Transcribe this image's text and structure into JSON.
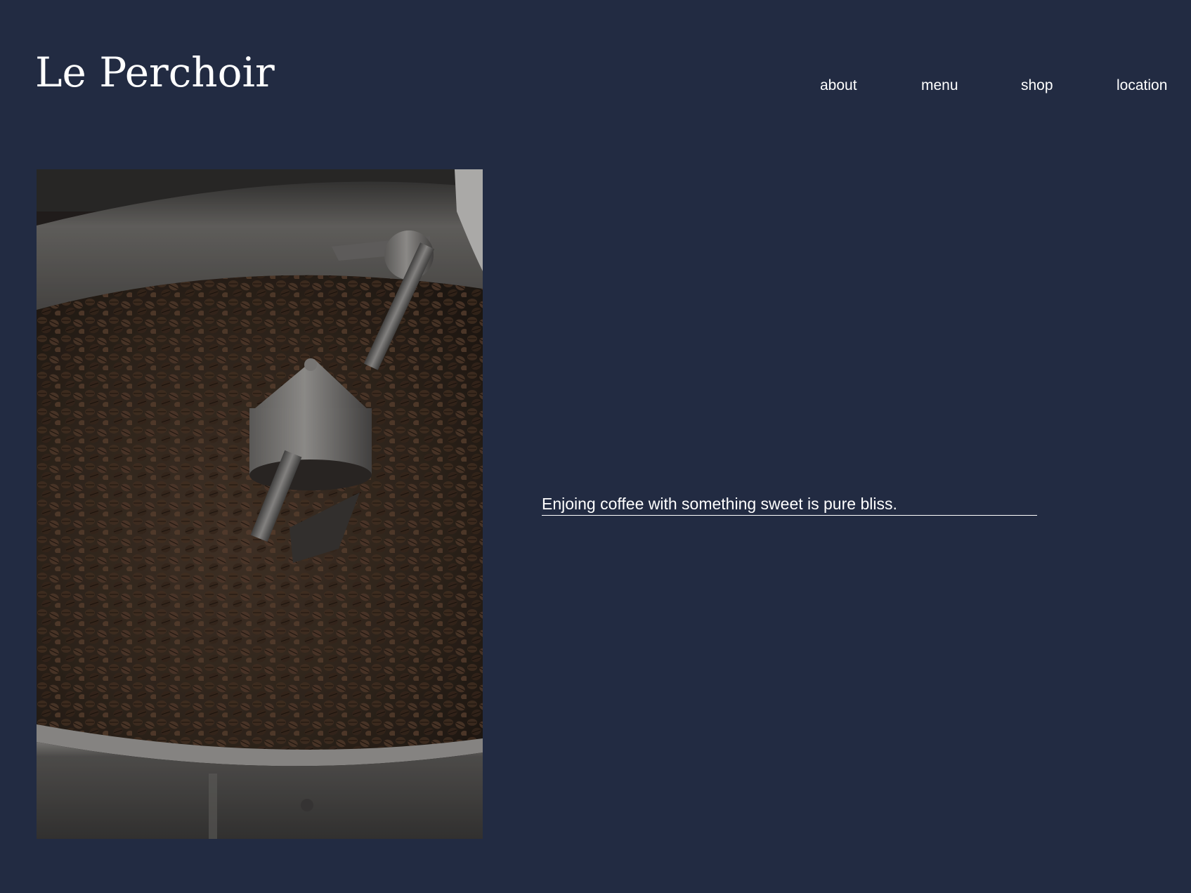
{
  "site": {
    "brand": "Le Perchoir"
  },
  "nav": {
    "items": [
      {
        "label": "about"
      },
      {
        "label": "menu"
      },
      {
        "label": "shop"
      },
      {
        "label": "location"
      }
    ]
  },
  "hero": {
    "image_subject": "coffee-roaster-image",
    "tagline": "Enjoing coffee with something sweet is pure bliss."
  },
  "colors": {
    "background": "#222b42",
    "text": "#ffffff"
  }
}
